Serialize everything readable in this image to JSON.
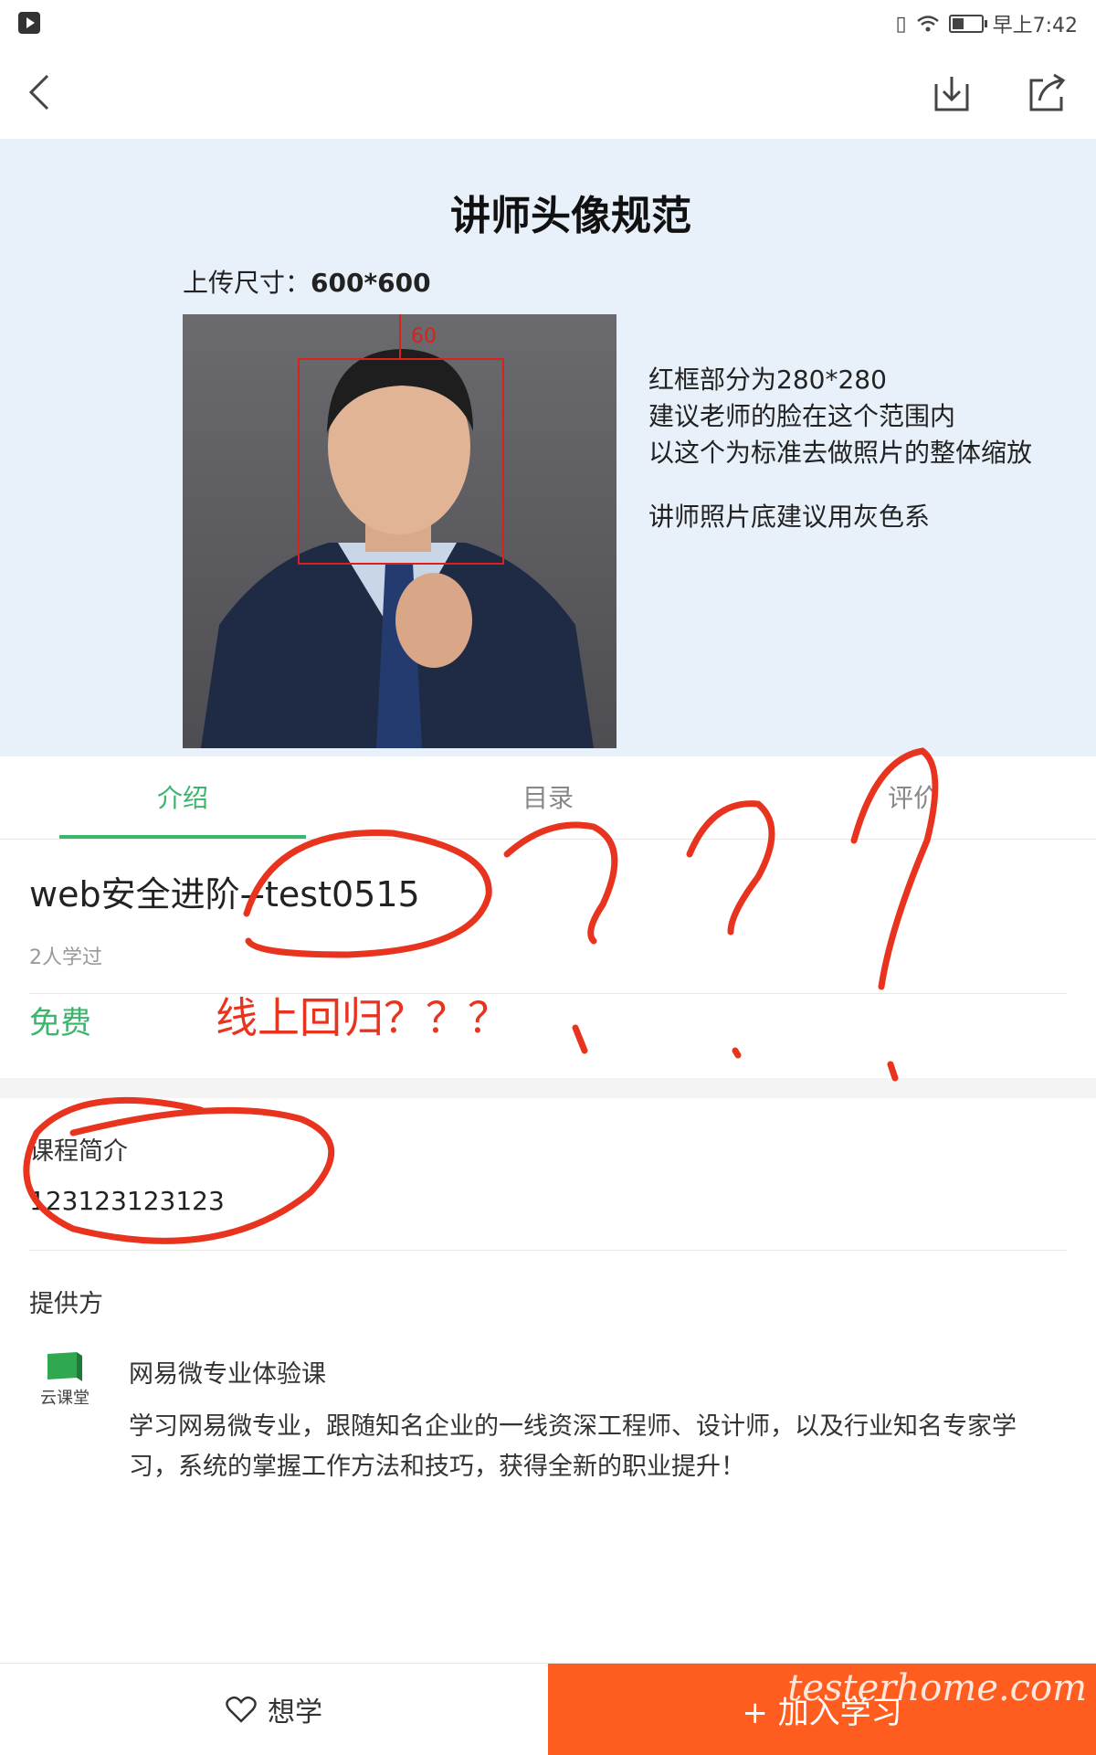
{
  "status_bar": {
    "time": "早上7:42"
  },
  "banner": {
    "title": "讲师头像规范",
    "upload_label": "上传尺寸：",
    "upload_value": "600*600",
    "box_label": "60",
    "notes": [
      "红框部分为280*280",
      "建议老师的脸在这个范围内",
      "以这个为标准去做照片的整体缩放",
      "讲师照片底建议用灰色系"
    ]
  },
  "tabs": [
    {
      "label": "介绍",
      "active": true
    },
    {
      "label": "目录",
      "active": false
    },
    {
      "label": "评价",
      "active": false
    }
  ],
  "course": {
    "title": "web安全进阶--test0515",
    "learners": "2人学过",
    "price": "免费"
  },
  "intro": {
    "heading": "课程简介",
    "text": "123123123123"
  },
  "provider": {
    "heading": "提供方",
    "logo_text": "云课堂",
    "name": "网易微专业体验课",
    "description": "学习网易微专业，跟随知名企业的一线资深工程师、设计师，以及行业知名专家学习，系统的掌握工作方法和技巧，获得全新的职业提升！"
  },
  "bottom_bar": {
    "wish_label": "想学",
    "join_label": "+ 加入学习"
  },
  "watermark": "testerhome.com",
  "annotation": {
    "text": "线上回归？？？"
  },
  "colors": {
    "accent_green": "#3bb56b",
    "cta_orange": "#ff5d20",
    "annotation_red": "#e8331f"
  }
}
